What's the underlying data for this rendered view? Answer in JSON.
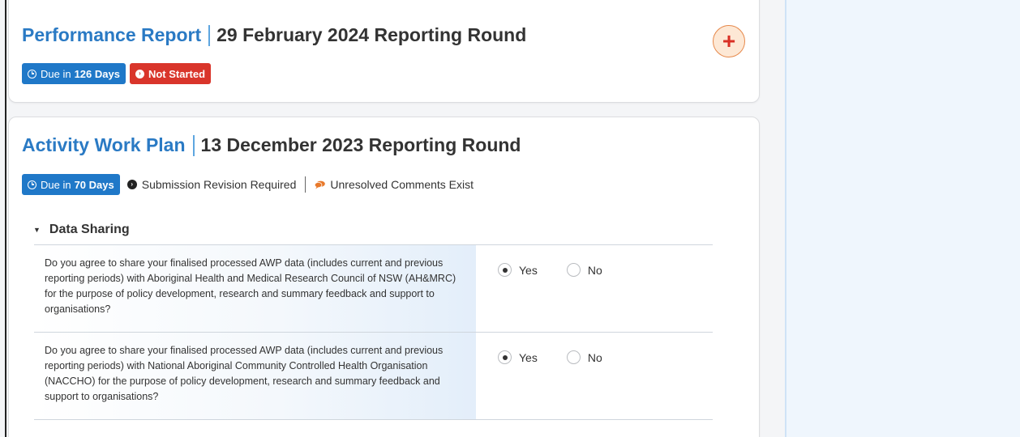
{
  "performance_report": {
    "title": "Performance Report",
    "round": "29 February 2024 Reporting Round",
    "due_prefix": "Due in",
    "due_days": "126 Days",
    "status": "Not Started",
    "add_label": "+"
  },
  "activity_work_plan": {
    "title": "Activity Work Plan",
    "round": "13 December 2023 Reporting Round",
    "due_prefix": "Due in",
    "due_days": "70 Days",
    "status": "Submission Revision Required",
    "comments": "Unresolved Comments Exist",
    "section": {
      "title": "Data Sharing",
      "questions": [
        {
          "text": "Do you agree to share your finalised processed AWP data (includes current and previous reporting periods) with Aboriginal Health and Medical Research Council of NSW (AH&MRC) for the purpose of policy development, research and summary feedback and support to organisations?",
          "yes": "Yes",
          "no": "No",
          "selected": "Yes"
        },
        {
          "text": "Do you agree to share your finalised processed AWP data (includes current and previous reporting periods) with National Aboriginal Community Controlled Health Organisation (NACCHO) for the purpose of policy development, research and summary feedback and support to organisations?",
          "yes": "Yes",
          "no": "No",
          "selected": "Yes"
        }
      ]
    }
  },
  "colors": {
    "title_blue": "#2a7ac4",
    "badge_blue": "#1f78c8",
    "badge_red": "#d9352b",
    "comment_orange": "#e8792b"
  }
}
